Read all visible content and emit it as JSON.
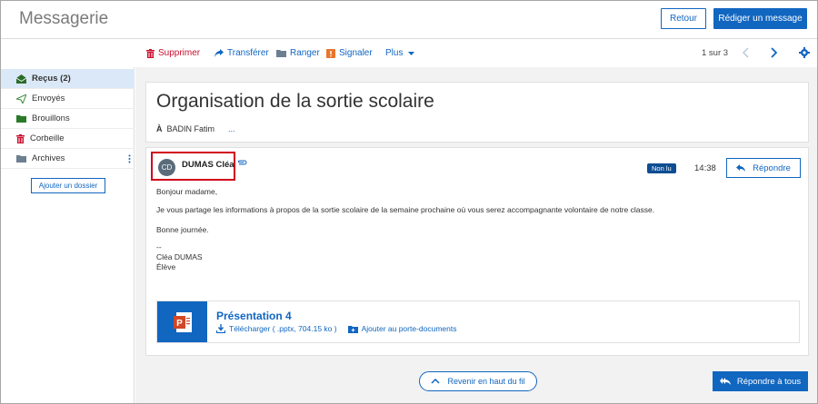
{
  "header": {
    "title": "Messagerie",
    "back_label": "Retour",
    "compose_label": "Rédiger un message"
  },
  "toolbar": {
    "delete_label": "Supprimer",
    "forward_label": "Transférer",
    "archive_label": "Ranger",
    "report_label": "Signaler",
    "more_label": "Plus",
    "pager": "1 sur 3"
  },
  "sidebar": {
    "items": [
      {
        "label": "Reçus (2)",
        "icon": "inbox-icon"
      },
      {
        "label": "Envoyés",
        "icon": "sent-icon"
      },
      {
        "label": "Brouillons",
        "icon": "folder-icon"
      },
      {
        "label": "Corbeille",
        "icon": "trash-icon"
      },
      {
        "label": "Archives",
        "icon": "folder-icon"
      }
    ],
    "add_folder_label": "Ajouter un dossier"
  },
  "thread": {
    "subject": "Organisation de la sortie scolaire",
    "to_prefix": "À",
    "recipient": "BADIN Fatim",
    "more_recipients": "..."
  },
  "message": {
    "avatar_initials": "CD",
    "sender": "DUMAS Cléa",
    "status_badge": "Non lu",
    "time": "14:38",
    "reply_label": "Répondre",
    "body": {
      "greeting": "Bonjour madame,",
      "paragraph": "Je vous partage les informations à propos de la sortie scolaire de la semaine prochaine où vous serez accompagnante volontaire de notre classe.",
      "closing": "Bonne journée.",
      "sig_sep": "--",
      "sig_name": "Cléa DUMAS",
      "sig_role": "Élève"
    },
    "attachment": {
      "name": "Présentation 4",
      "download_label": "Télécharger ( .pptx, 704.15 ko )",
      "add_label": "Ajouter au porte-documents"
    }
  },
  "footer": {
    "back_top_label": "Revenir en haut du fil",
    "reply_all_label": "Répondre à tous"
  },
  "colors": {
    "accent": "#1166c0",
    "danger": "#c8102e",
    "highlight_box": "#d0021b",
    "badge": "#0e4d92"
  }
}
